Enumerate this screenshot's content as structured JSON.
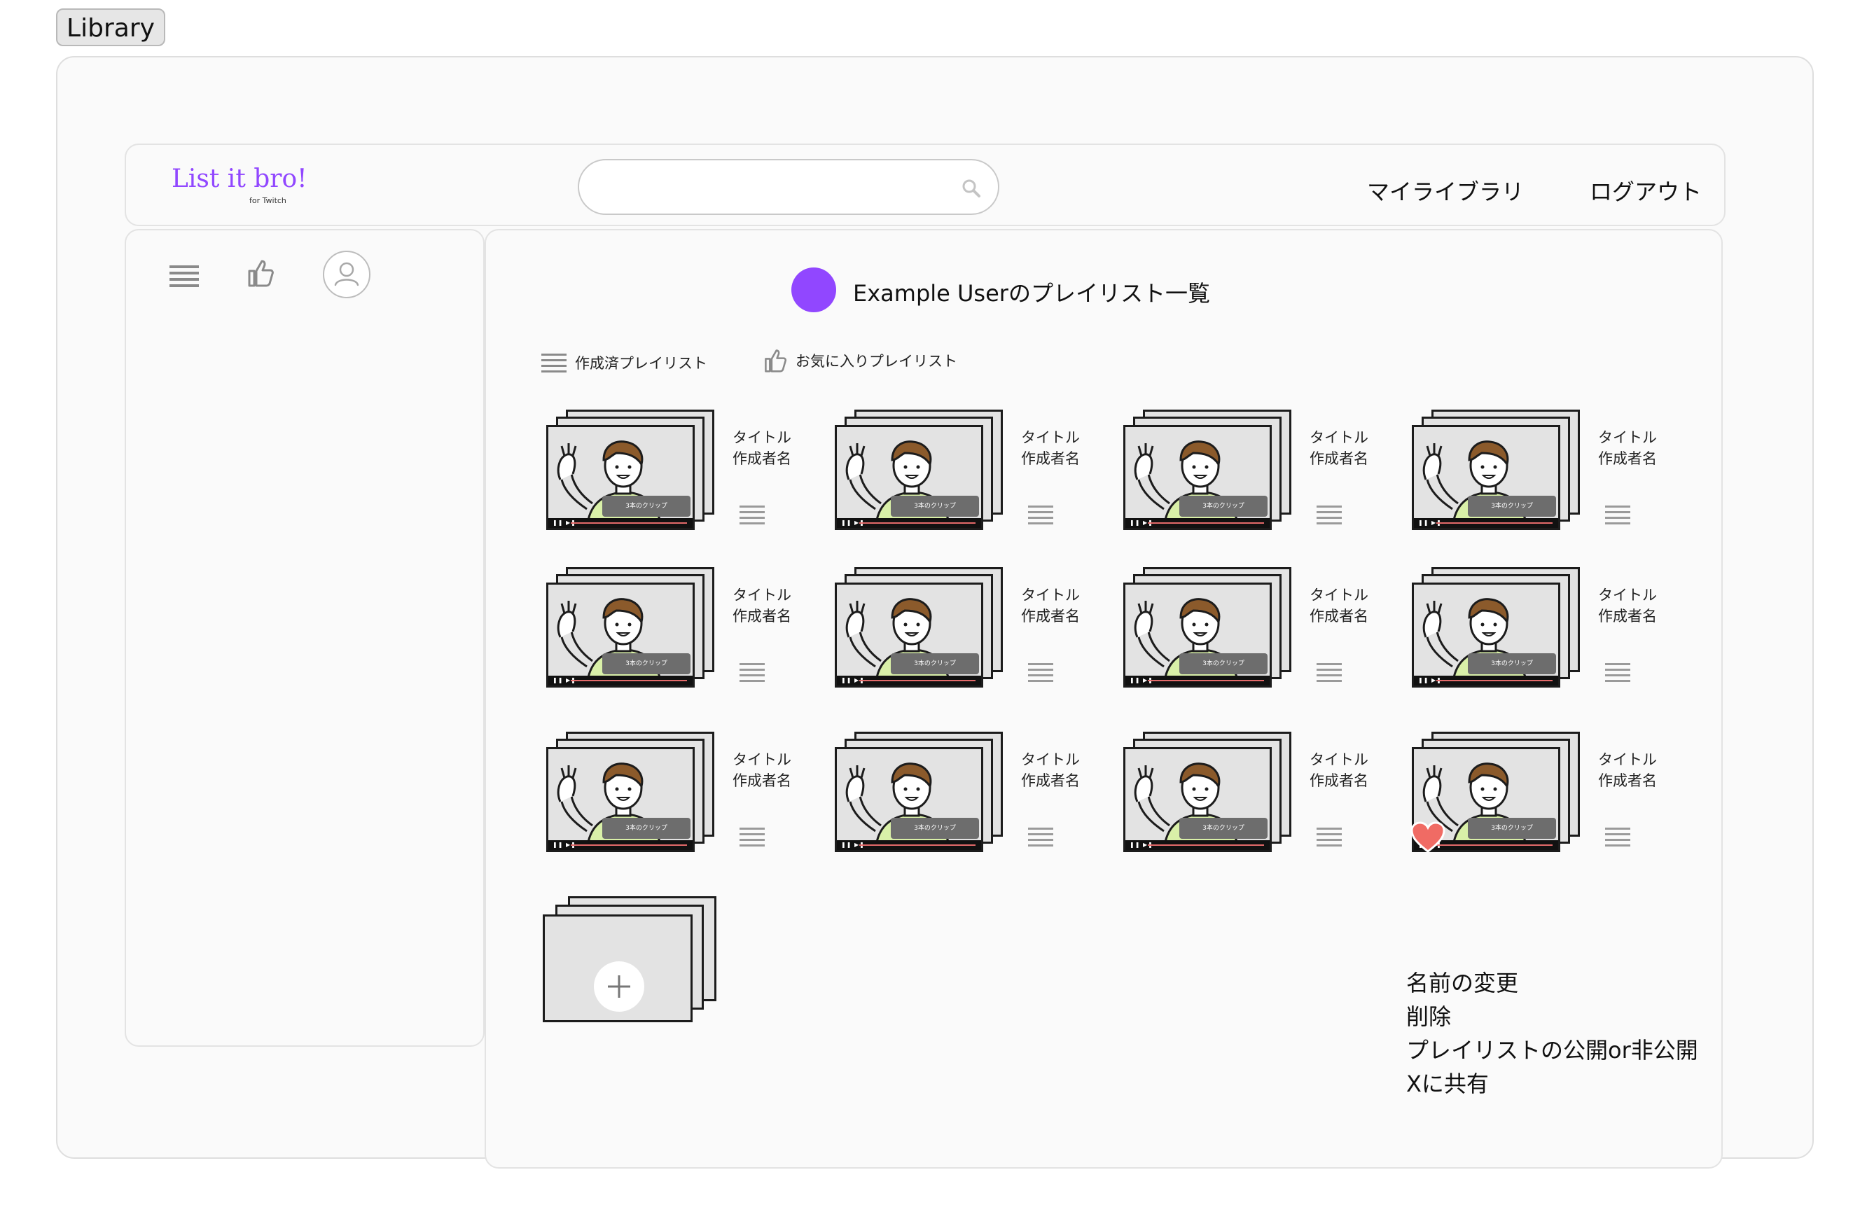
{
  "frame": {
    "tab_label": "Library"
  },
  "header": {
    "logo": "List it bro!",
    "logo_sub": "for Twitch",
    "search_placeholder": "",
    "nav": {
      "my_library": "マイライブラリ",
      "logout": "ログアウト"
    }
  },
  "sidebar": {
    "icons": [
      "list-icon",
      "thumbs-up-icon",
      "user-avatar-icon"
    ]
  },
  "main": {
    "title": "Example Userのプレイリスト一覧",
    "tabs": {
      "created": "作成済プレイリスト",
      "favorites": "お気に入りプレイリスト"
    },
    "cards": [
      {
        "title": "タイトル",
        "author": "作成者名",
        "badge": "3本のクリップ",
        "favorited": false
      },
      {
        "title": "タイトル",
        "author": "作成者名",
        "badge": "3本のクリップ",
        "favorited": false
      },
      {
        "title": "タイトル",
        "author": "作成者名",
        "badge": "3本のクリップ",
        "favorited": false
      },
      {
        "title": "タイトル",
        "author": "作成者名",
        "badge": "3本のクリップ",
        "favorited": false
      },
      {
        "title": "タイトル",
        "author": "作成者名",
        "badge": "3本のクリップ",
        "favorited": false
      },
      {
        "title": "タイトル",
        "author": "作成者名",
        "badge": "3本のクリップ",
        "favorited": false
      },
      {
        "title": "タイトル",
        "author": "作成者名",
        "badge": "3本のクリップ",
        "favorited": false
      },
      {
        "title": "タイトル",
        "author": "作成者名",
        "badge": "3本のクリップ",
        "favorited": false
      },
      {
        "title": "タイトル",
        "author": "作成者名",
        "badge": "3本のクリップ",
        "favorited": false
      },
      {
        "title": "タイトル",
        "author": "作成者名",
        "badge": "3本のクリップ",
        "favorited": false
      },
      {
        "title": "タイトル",
        "author": "作成者名",
        "badge": "3本のクリップ",
        "favorited": false
      },
      {
        "title": "タイトル",
        "author": "作成者名",
        "badge": "3本のクリップ",
        "favorited": true
      }
    ],
    "context_menu": [
      "名前の変更",
      "削除",
      "プレイリストの公開or非公開",
      "Xに共有"
    ]
  },
  "colors": {
    "accent": "#9147ff",
    "heart": "#f06b64"
  }
}
